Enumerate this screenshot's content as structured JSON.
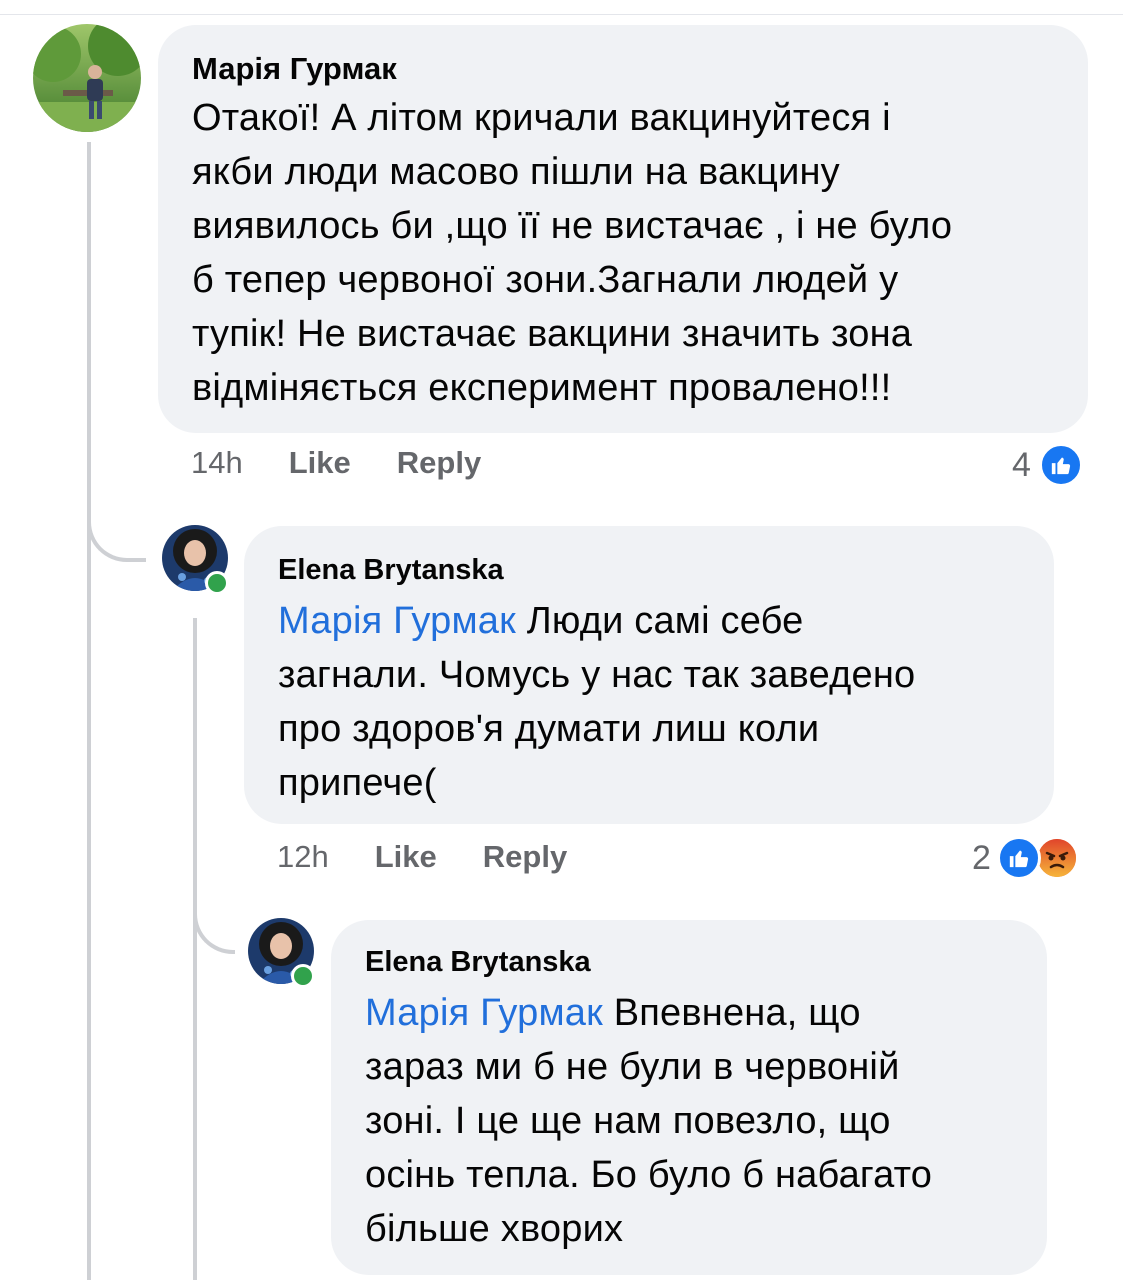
{
  "comments": [
    {
      "author": "Марія Гурмак",
      "text": "Отакої! А літом кричали вакцинуйтеся і якби люди масово пішли на вакцину виявилось би ,що її не вистачає , і не було б тепер червоної зони.Загнали людей у тупік! Не вистачає вакцини значить зона відміняється експеримент провалено!!!",
      "lines": [
        "Отакої! А літом кричали вакцинуйтеся і",
        "якби люди масово пішли на вакцину",
        "виявилось би ,що її не вистачає , і не було",
        "б тепер червоної зони.Загнали людей у",
        "тупік! Не вистачає вакцини значить зона",
        "відміняється експеримент провалено!!!"
      ],
      "time": "14h",
      "like_label": "Like",
      "reply_label": "Reply",
      "reaction_count": "4",
      "reactions": [
        "like-icon"
      ]
    },
    {
      "author": "Elena Brytanska",
      "mention": "Марія Гурмак",
      "lines": [
        " Люди самі себе",
        "загнали. Чомусь у нас так заведено",
        "про здоров'я думати лиш коли",
        "припече("
      ],
      "time": "12h",
      "like_label": "Like",
      "reply_label": "Reply",
      "reaction_count": "2",
      "reactions": [
        "like-icon",
        "angry-icon"
      ]
    },
    {
      "author": "Elena Brytanska",
      "mention": "Марія Гурмак",
      "lines": [
        " Впевнена, що",
        "зараз ми б не були в червоній",
        "зоні. І це ще нам повезло, що",
        "осінь тепла. Бо було б набагато",
        "більше хворих"
      ]
    }
  ],
  "colors": {
    "bubble": "#f0f2f5",
    "mention": "#216fdb",
    "meta": "#65676b",
    "like": "#1877f2",
    "angry": "#f26b2f",
    "online": "#31a24c"
  }
}
